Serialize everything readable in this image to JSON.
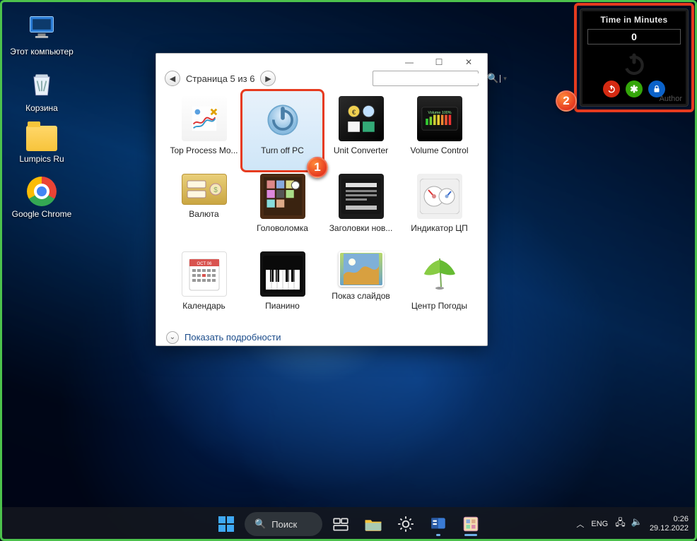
{
  "desktop": {
    "icons": [
      {
        "id": "this-pc",
        "label": "Этот компьютер"
      },
      {
        "id": "recycle-bin",
        "label": "Корзина"
      },
      {
        "id": "folder",
        "label": "Lumpics Ru"
      },
      {
        "id": "chrome",
        "label": "Google Chrome"
      }
    ]
  },
  "gadget_panel": {
    "title": "Time in Minutes",
    "value": "0",
    "author_label": "Author",
    "buttons": [
      "power",
      "refresh",
      "lock"
    ]
  },
  "callouts": {
    "one": "1",
    "two": "2"
  },
  "gallery_window": {
    "nav": {
      "page_label": "Страница 5 из 6",
      "search_placeholder": ""
    },
    "gadgets": [
      {
        "id": "top-process",
        "label": "Top Process Mo..."
      },
      {
        "id": "turn-off-pc",
        "label": "Turn off PC",
        "selected": true
      },
      {
        "id": "unit-conv",
        "label": "Unit Converter"
      },
      {
        "id": "vol-control",
        "label": "Volume Control"
      },
      {
        "id": "currency",
        "label": "Валюта"
      },
      {
        "id": "puzzle",
        "label": "Головоломка"
      },
      {
        "id": "news",
        "label": "Заголовки нов..."
      },
      {
        "id": "cpu",
        "label": "Индикатор ЦП"
      },
      {
        "id": "calendar",
        "label": "Календарь"
      },
      {
        "id": "piano",
        "label": "Пианино"
      },
      {
        "id": "slideshow",
        "label": "Показ слайдов"
      },
      {
        "id": "weather",
        "label": "Центр Погоды"
      }
    ],
    "footer_link": "Показать подробности"
  },
  "taskbar": {
    "search_label": "Поиск",
    "lang": "ENG",
    "time": "0:26",
    "date": "29.12.2022"
  }
}
